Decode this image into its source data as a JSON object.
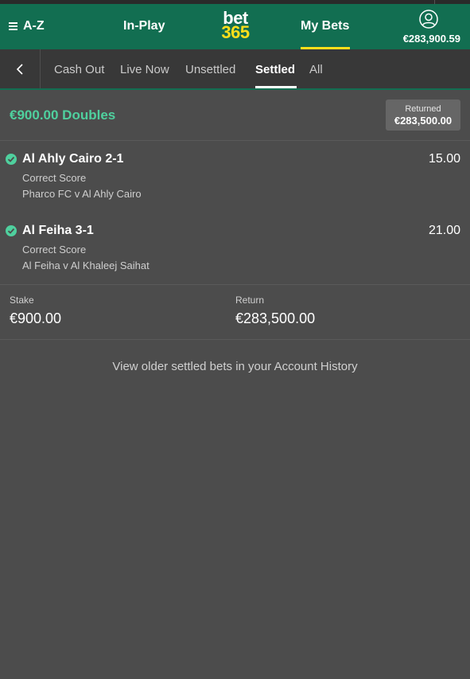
{
  "header": {
    "az_label": "A-Z",
    "inplay_label": "In-Play",
    "logo_top": "bet",
    "logo_bottom": "365",
    "mybets_label": "My Bets",
    "balance": "€283,900.59"
  },
  "tabs": [
    "Cash Out",
    "Live Now",
    "Unsettled",
    "Settled",
    "All"
  ],
  "bet": {
    "title": "€900.00 Doubles",
    "returned_label": "Returned",
    "returned_amount": "€283,500.00",
    "selections": [
      {
        "name": "Al Ahly Cairo 2-1",
        "odds": "15.00",
        "market": "Correct Score",
        "event": "Pharco FC v Al Ahly Cairo"
      },
      {
        "name": "Al Feiha 3-1",
        "odds": "21.00",
        "market": "Correct Score",
        "event": "Al Feiha v Al Khaleej Saihat"
      }
    ],
    "stake_label": "Stake",
    "stake_value": "€900.00",
    "return_label": "Return",
    "return_value": "€283,500.00"
  },
  "history_link": "View older settled bets in your Account History",
  "colors": {
    "brand_green": "#126e51",
    "accent_yellow": "#ffdf1b",
    "win_green": "#4fd09e"
  }
}
